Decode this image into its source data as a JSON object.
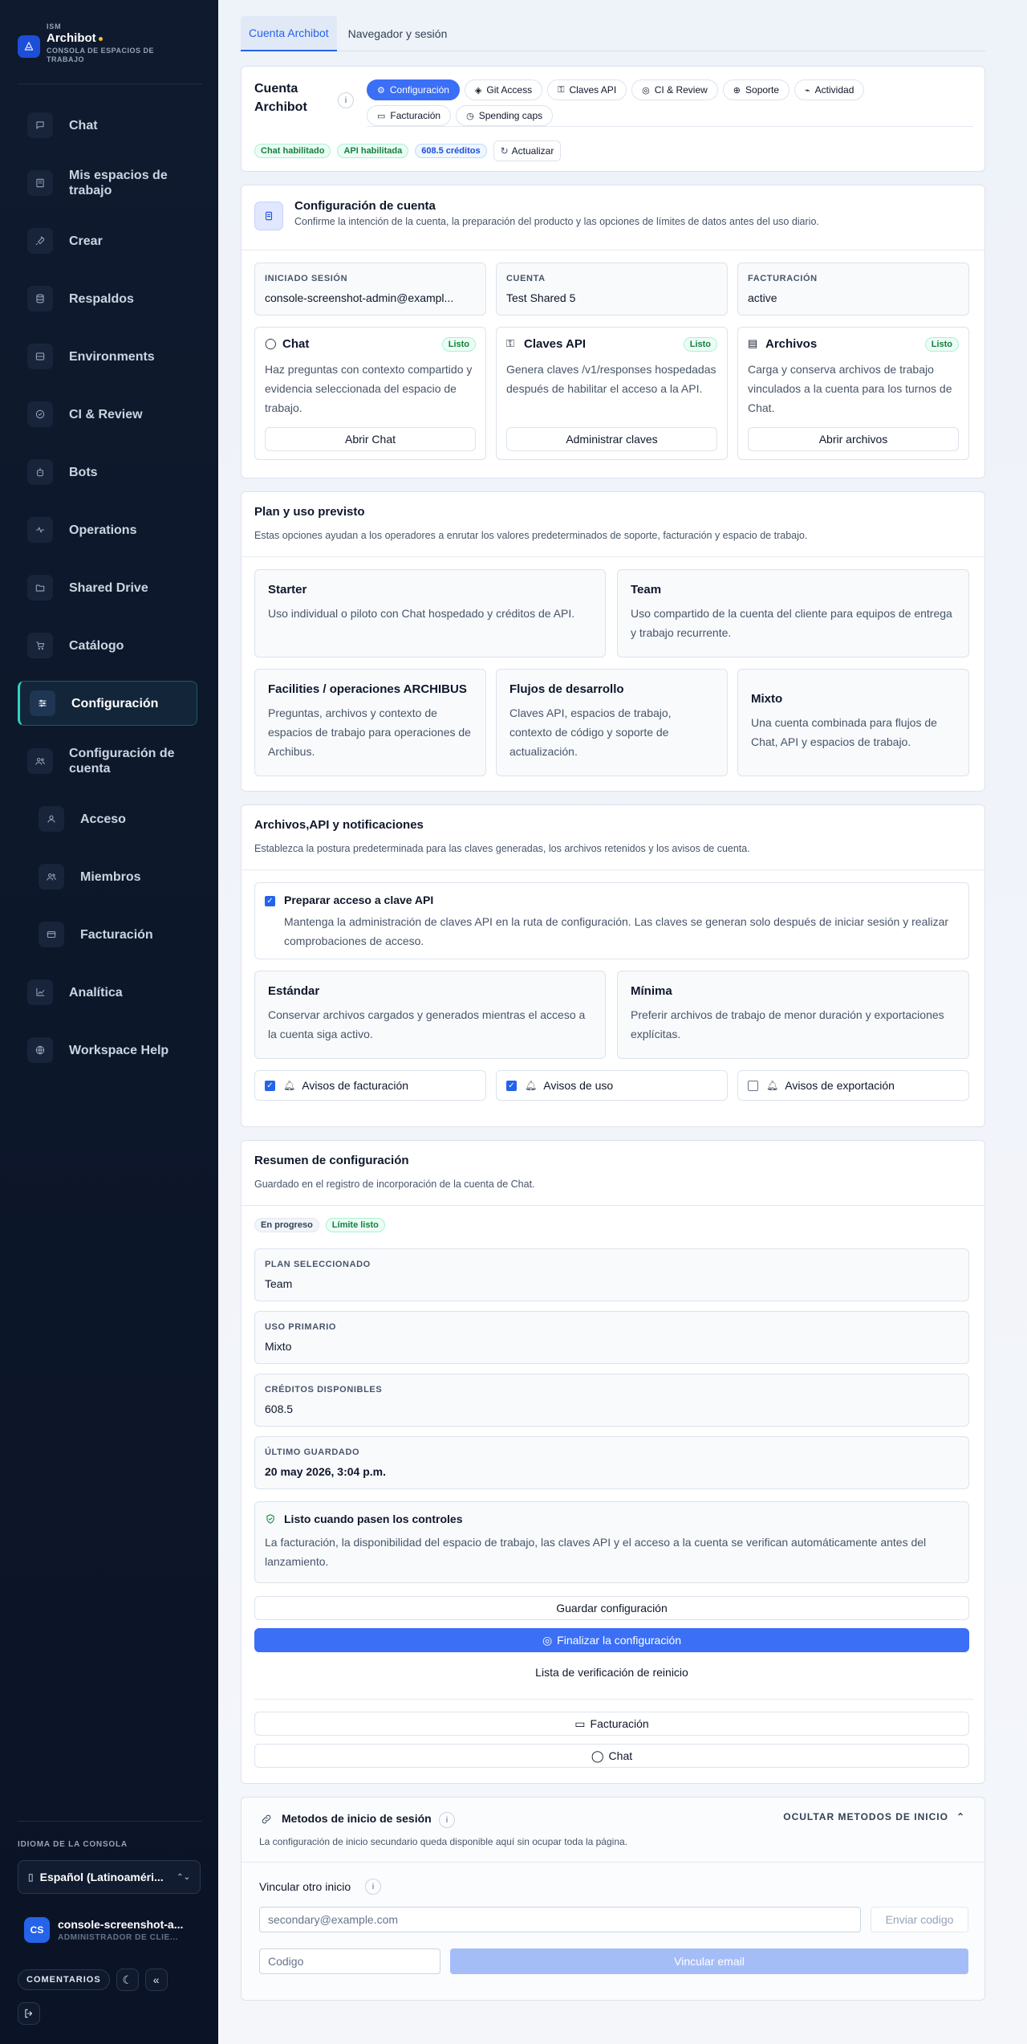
{
  "brand": {
    "ism": "ISM",
    "name": "Archibot",
    "subtitle": "CONSOLA DE ESPACIOS DE TRABAJO"
  },
  "nav": [
    {
      "label": "Chat",
      "icon": "chat-icon"
    },
    {
      "label": "Mis espacios de trabajo",
      "icon": "workspaces-icon"
    },
    {
      "label": "Crear",
      "icon": "rocket-icon"
    },
    {
      "label": "Respaldos",
      "icon": "database-icon"
    },
    {
      "label": "Environments",
      "icon": "server-icon"
    },
    {
      "label": "CI & Review",
      "icon": "check-circle-icon"
    },
    {
      "label": "Bots",
      "icon": "bot-icon"
    },
    {
      "label": "Operations",
      "icon": "activity-icon"
    },
    {
      "label": "Shared Drive",
      "icon": "folder-icon"
    },
    {
      "label": "Catálogo",
      "icon": "cart-icon"
    },
    {
      "label": "Configuración",
      "icon": "sliders-icon",
      "active": true
    },
    {
      "label": "Configuración de cuenta",
      "icon": "users-icon"
    },
    {
      "label": "Acceso",
      "icon": "user-icon",
      "sub": true
    },
    {
      "label": "Miembros",
      "icon": "users-icon",
      "sub": true
    },
    {
      "label": "Facturación",
      "icon": "card-icon",
      "sub": true
    },
    {
      "label": "Analítica",
      "icon": "chart-icon"
    },
    {
      "label": "Workspace Help",
      "icon": "help-icon"
    }
  ],
  "sidebar_footer": {
    "lang_label": "IDIOMA DE LA CONSOLA",
    "lang_value": "Español (Latinoaméri...",
    "user_initials": "CS",
    "user_name": "console-screenshot-a...",
    "user_role": "ADMINISTRADOR DE CLIE...",
    "feedback": "COMENTARIOS"
  },
  "tabs": [
    "Cuenta Archibot",
    "Navegador y sesión"
  ],
  "account_header": {
    "title": "Cuenta Archibot",
    "info": "i",
    "pills": [
      "Configuración",
      "Git Access",
      "Claves API",
      "CI & Review",
      "Soporte",
      "Actividad",
      "Facturación",
      "Spending caps"
    ],
    "status": [
      "Chat habilitado",
      "API habilitada",
      "608.5 créditos"
    ],
    "refresh": "Actualizar"
  },
  "config": {
    "title": "Configuración de cuenta",
    "subtitle": "Confirme la intención de la cuenta, la preparación del producto y las opciones de límites de datos antes del uso diario.",
    "kv": [
      {
        "k": "INICIADO SESIÓN",
        "v": "console-screenshot-admin@exampl..."
      },
      {
        "k": "CUENTA",
        "v": "Test Shared 5"
      },
      {
        "k": "FACTURACIÓN",
        "v": "active"
      }
    ],
    "features": [
      {
        "title": "Chat",
        "badge": "Listo",
        "desc": "Haz preguntas con contexto compartido y evidencia seleccionada del espacio de trabajo.",
        "action": "Abrir Chat"
      },
      {
        "title": "Claves API",
        "badge": "Listo",
        "desc": "Genera claves /v1/responses hospedadas después de habilitar el acceso a la API.",
        "action": "Administrar claves"
      },
      {
        "title": "Archivos",
        "badge": "Listo",
        "desc": "Carga y conserva archivos de trabajo vinculados a la cuenta para los turnos de Chat.",
        "action": "Abrir archivos"
      }
    ]
  },
  "plan": {
    "title": "Plan y uso previsto",
    "subtitle": "Estas opciones ayudan a los operadores a enrutar los valores predeterminados de soporte, facturación y espacio de trabajo.",
    "options": [
      {
        "title": "Starter",
        "desc": "Uso individual o piloto con Chat hospedado y créditos de API."
      },
      {
        "title": "Team",
        "desc": "Uso compartido de la cuenta del cliente para equipos de entrega y trabajo recurrente."
      },
      {
        "title": "Facilities / operaciones ARCHIBUS",
        "desc": "Preguntas, archivos y contexto de espacios de trabajo para operaciones de Archibus."
      },
      {
        "title": "Flujos de desarrollo",
        "desc": "Claves API, espacios de trabajo, contexto de código y soporte de actualización."
      },
      {
        "title": "Mixto",
        "desc": "Una cuenta combinada para flujos de Chat, API y espacios de trabajo."
      }
    ]
  },
  "files": {
    "title": "Archivos,API y notificaciones",
    "subtitle": "Establezca la postura predeterminada para las claves generadas, los archivos retenidos y los avisos de cuenta.",
    "api_label": "Preparar acceso a clave API",
    "api_desc": "Mantenga la administración de claves API en la ruta de configuración. Las claves se generan solo después de iniciar sesión y realizar comprobaciones de acceso.",
    "retention": [
      {
        "title": "Estándar",
        "desc": "Conservar archivos cargados y generados mientras el acceso a la cuenta siga activo."
      },
      {
        "title": "Mínima",
        "desc": "Preferir archivos de trabajo de menor duración y exportaciones explícitas."
      }
    ],
    "notices": [
      {
        "label": "Avisos de facturación",
        "checked": true
      },
      {
        "label": "Avisos de uso",
        "checked": true
      },
      {
        "label": "Avisos de exportación",
        "checked": false
      }
    ]
  },
  "summary": {
    "title": "Resumen de configuración",
    "subtitle": "Guardado en el registro de incorporación de la cuenta de Chat.",
    "tags": [
      "En progreso",
      "Límite listo"
    ],
    "kv": [
      {
        "k": "PLAN SELECCIONADO",
        "v": "Team"
      },
      {
        "k": "USO PRIMARIO",
        "v": "Mixto"
      },
      {
        "k": "CRÉDITOS DISPONIBLES",
        "v": "608.5"
      },
      {
        "k": "ÚLTIMO GUARDADO",
        "v": "20 may 2026, 3:04 p.m."
      }
    ],
    "ready_title": "Listo cuando pasen los controles",
    "ready_desc": "La facturación, la disponibilidad del espacio de trabajo, las claves API y el acceso a la cuenta se verifican automáticamente antes del lanzamiento.",
    "save": "Guardar configuración",
    "finish": "Finalizar la configuración",
    "reset": "Lista de verificación de reinicio",
    "billing": "Facturación",
    "chat": "Chat"
  },
  "login": {
    "title": "Metodos de inicio de sesión",
    "info": "i",
    "hide": "OCULTAR METODOS DE INICIO",
    "subtitle": "La configuración de inicio secundario queda disponible aquí sin ocupar toda la página.",
    "link_label": "Vincular otro inicio",
    "email_placeholder": "secondary@example.com",
    "send_code": "Enviar codigo",
    "code_placeholder": "Codigo",
    "link_email": "Vincular email"
  },
  "colors": {
    "accent": "#2563eb",
    "sidebar": "#0f1a2e",
    "active_border": "#2dd4bf",
    "success": "#15803d"
  }
}
